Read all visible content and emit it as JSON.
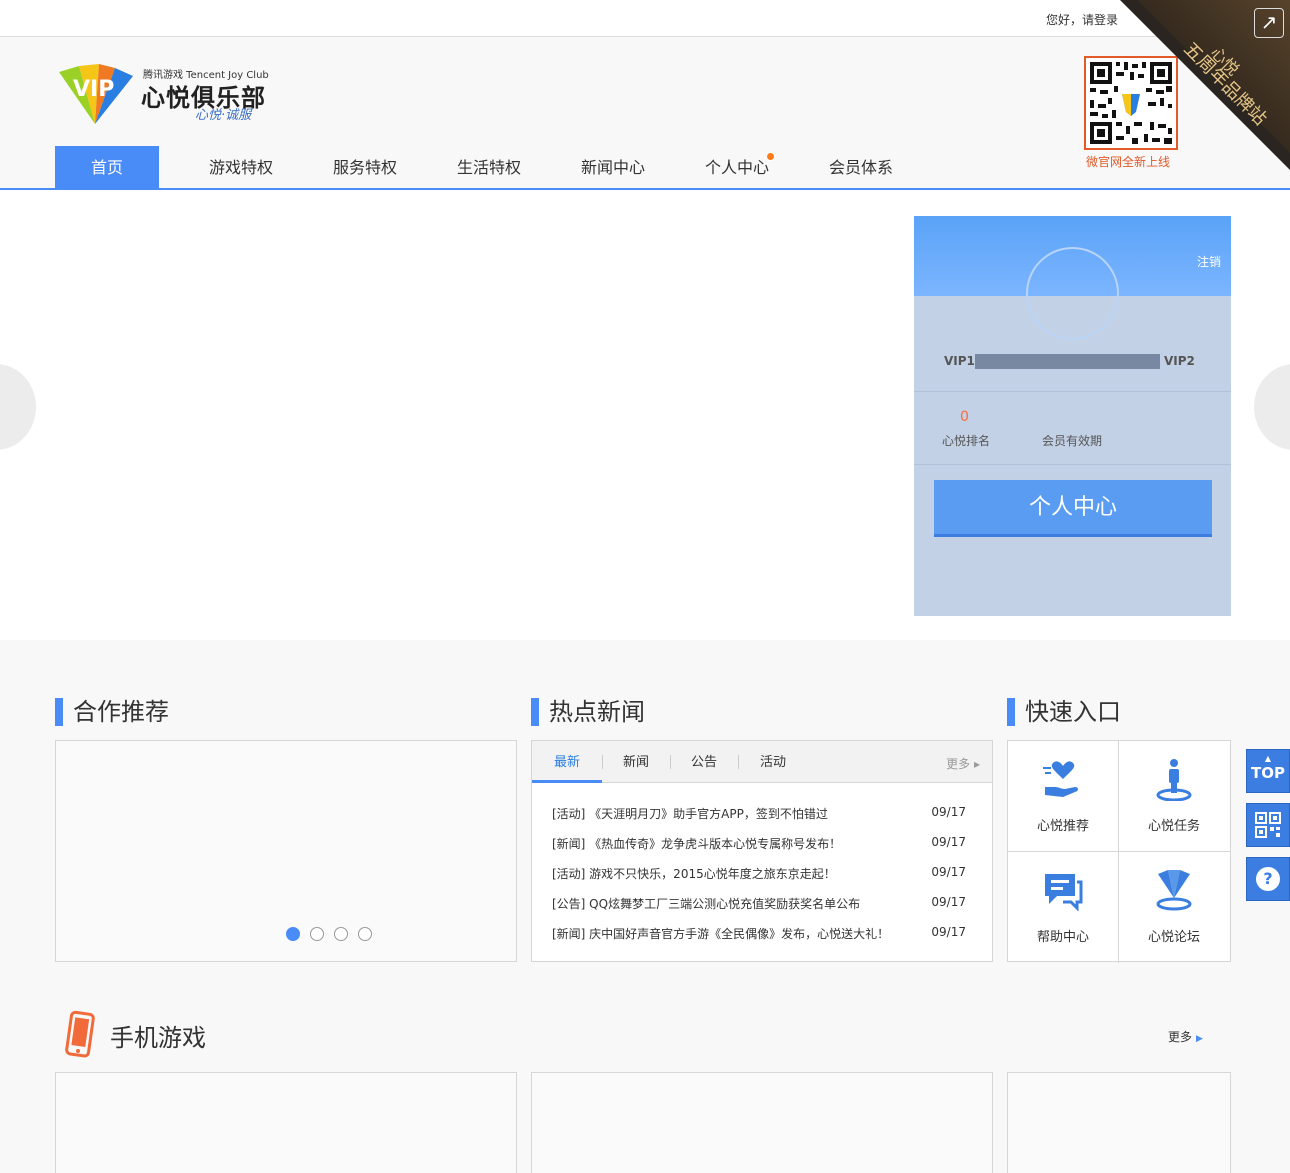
{
  "topbar": {
    "login_text": "您好，请登录"
  },
  "corner": {
    "line1": "心悦",
    "line2": "五周年品牌站",
    "open_icon": "external-link-icon"
  },
  "logo": {
    "small": "腾讯游戏 Tencent Joy Club",
    "big": "心悦俱乐部",
    "slogan": "心悦·诚服"
  },
  "nav": {
    "items": [
      "首页",
      "游戏特权",
      "服务特权",
      "生活特权",
      "新闻中心",
      "个人中心",
      "会员体系"
    ]
  },
  "qr": {
    "caption": "微官网全新上线"
  },
  "userbox": {
    "logout": "注销",
    "vip_left": "VIP1",
    "vip_right": "VIP2",
    "rank_value": "0",
    "rank_label": "心悦排名",
    "expiry_label": "会员有效期",
    "button": "个人中心"
  },
  "sections": {
    "partner": "合作推荐",
    "hotnews": "热点新闻",
    "quick": "快速入口",
    "mobile": "手机游戏",
    "more": "更多"
  },
  "news": {
    "tabs": [
      "最新",
      "新闻",
      "公告",
      "活动"
    ],
    "more": "更多",
    "items": [
      {
        "title": "[活动] 《天涯明月刀》助手官方APP，签到不怕错过",
        "date": "09/17"
      },
      {
        "title": "[新闻] 《热血传奇》龙争虎斗版本心悦专属称号发布！",
        "date": "09/17"
      },
      {
        "title": "[活动] 游戏不只快乐，2015心悦年度之旅东京走起！",
        "date": "09/17"
      },
      {
        "title": "[公告] QQ炫舞梦工厂三端公测心悦充值奖励获奖名单公布",
        "date": "09/17"
      },
      {
        "title": "[新闻] 庆中国好声音官方手游《全民偶像》发布，心悦送大礼！",
        "date": "09/17"
      }
    ]
  },
  "quick": {
    "items": [
      "心悦推荐",
      "心悦任务",
      "帮助中心",
      "心悦论坛"
    ]
  },
  "float": {
    "top": "TOP",
    "help": "?"
  }
}
